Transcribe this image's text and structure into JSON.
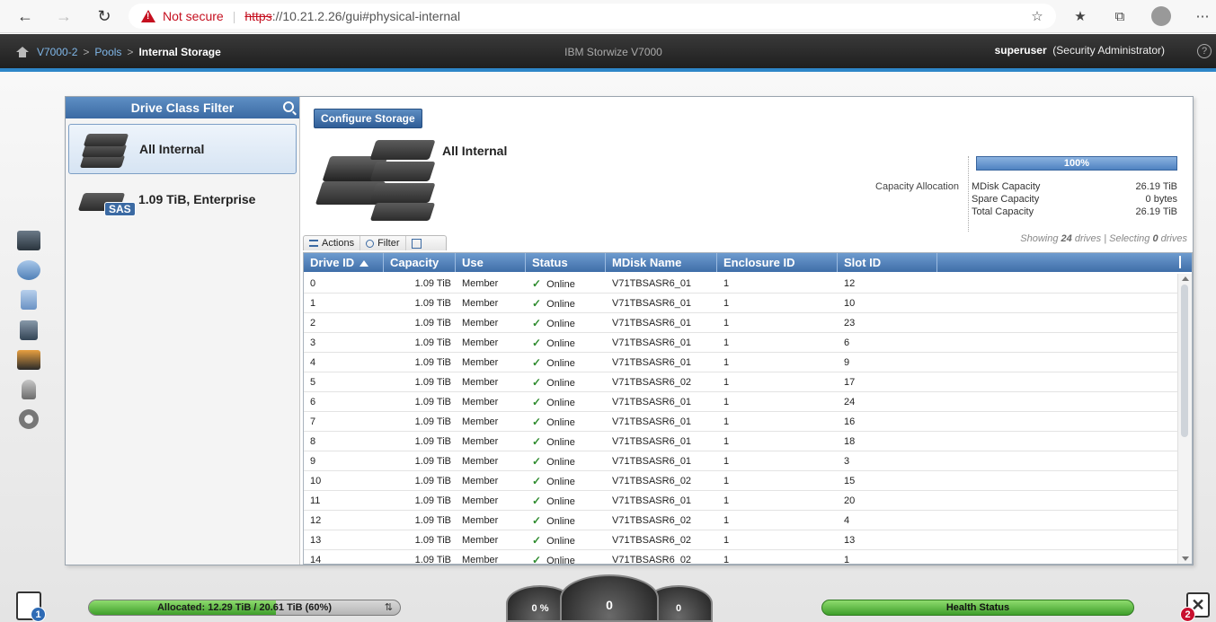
{
  "browser": {
    "security_label": "Not secure",
    "url_protocol": "https",
    "url_rest": "://10.21.2.26/gui#physical-internal"
  },
  "app_header": {
    "breadcrumb": [
      "V7000-2",
      "Pools",
      "Internal Storage"
    ],
    "breadcrumb_separator": ">",
    "product_name": "IBM Storwize V7000",
    "user_name": "superuser",
    "user_role": "(Security Administrator)",
    "help_label": "?"
  },
  "filter": {
    "title": "Drive Class Filter",
    "items": [
      {
        "label": "All Internal",
        "selected": true
      },
      {
        "label": "1.09 TiB, Enterprise",
        "badge": "SAS",
        "selected": false
      }
    ]
  },
  "details": {
    "configure_button": "Configure Storage",
    "title": "All Internal",
    "capacity_allocation_label": "Capacity Allocation",
    "capacity_percent_label": "100%",
    "capacity_fraction": 1.0,
    "capacity_rows": [
      {
        "label": "MDisk Capacity",
        "value": "26.19 TiB"
      },
      {
        "label": "Spare Capacity",
        "value": "0 bytes"
      },
      {
        "label": "Total Capacity",
        "value": "26.19 TiB"
      }
    ],
    "showing_prefix": "Showing ",
    "showing_count": "24",
    "showing_middle": " drives | Selecting ",
    "selecting_count": "0",
    "showing_suffix": " drives"
  },
  "toolbar": {
    "actions_label": "Actions",
    "filter_label": "Filter"
  },
  "table": {
    "columns": [
      "Drive ID",
      "Capacity",
      "Use",
      "Status",
      "MDisk Name",
      "Enclosure ID",
      "Slot ID"
    ],
    "sorted_column": "Drive ID",
    "rows": [
      [
        "0",
        "1.09 TiB",
        "Member",
        "Online",
        "V71TBSASR6_01",
        "1",
        "12"
      ],
      [
        "1",
        "1.09 TiB",
        "Member",
        "Online",
        "V71TBSASR6_01",
        "1",
        "10"
      ],
      [
        "2",
        "1.09 TiB",
        "Member",
        "Online",
        "V71TBSASR6_01",
        "1",
        "23"
      ],
      [
        "3",
        "1.09 TiB",
        "Member",
        "Online",
        "V71TBSASR6_01",
        "1",
        "6"
      ],
      [
        "4",
        "1.09 TiB",
        "Member",
        "Online",
        "V71TBSASR6_01",
        "1",
        "9"
      ],
      [
        "5",
        "1.09 TiB",
        "Member",
        "Online",
        "V71TBSASR6_02",
        "1",
        "17"
      ],
      [
        "6",
        "1.09 TiB",
        "Member",
        "Online",
        "V71TBSASR6_01",
        "1",
        "24"
      ],
      [
        "7",
        "1.09 TiB",
        "Member",
        "Online",
        "V71TBSASR6_01",
        "1",
        "16"
      ],
      [
        "8",
        "1.09 TiB",
        "Member",
        "Online",
        "V71TBSASR6_01",
        "1",
        "18"
      ],
      [
        "9",
        "1.09 TiB",
        "Member",
        "Online",
        "V71TBSASR6_01",
        "1",
        "3"
      ],
      [
        "10",
        "1.09 TiB",
        "Member",
        "Online",
        "V71TBSASR6_02",
        "1",
        "15"
      ],
      [
        "11",
        "1.09 TiB",
        "Member",
        "Online",
        "V71TBSASR6_01",
        "1",
        "20"
      ],
      [
        "12",
        "1.09 TiB",
        "Member",
        "Online",
        "V71TBSASR6_02",
        "1",
        "4"
      ],
      [
        "13",
        "1.09 TiB",
        "Member",
        "Online",
        "V71TBSASR6_02",
        "1",
        "13"
      ],
      [
        "14",
        "1.09 TiB",
        "Member",
        "Online",
        "V71TBSASR6_02",
        "1",
        "1"
      ]
    ]
  },
  "status_bar": {
    "allocated_label": "Allocated: 12.29 TiB / 20.61 TiB (60%)",
    "allocated_fraction": 0.6,
    "gauge_left": "0 %",
    "gauge_center": "0",
    "gauge_right": "0",
    "health_label": "Health Status",
    "tasks_badge": "1",
    "events_badge": "2"
  },
  "colors": {
    "header_blue": "#3f6ea8",
    "accent_stripe": "#2e86c8",
    "health_green": "#3f9e2b",
    "online_check": "#2e8b2e",
    "warning_red": "#c50f1f"
  }
}
